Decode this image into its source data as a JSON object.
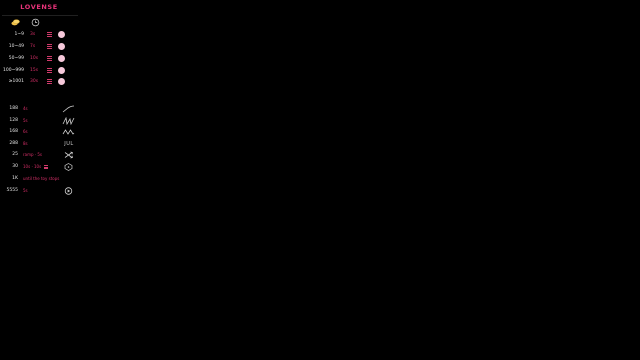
{
  "brand": {
    "name": "LOVENSE",
    "color": "#e8337a"
  },
  "colors": {
    "accent": "#d62f68",
    "text": "#e6e6e6",
    "background": "#000000"
  },
  "header": {
    "icons": [
      "tokens-icon",
      "timer-icon"
    ]
  },
  "tip_levels": [
    {
      "amount": "1~9",
      "duration": "3s",
      "level_icon": "level-bars-icon",
      "indicator_icon": "pink-dot-icon"
    },
    {
      "amount": "10~49",
      "duration": "7s",
      "level_icon": "level-bars-icon",
      "indicator_icon": "pink-dot-icon"
    },
    {
      "amount": "50~99",
      "duration": "10s",
      "level_icon": "level-bars-icon",
      "indicator_icon": "pink-dot-icon"
    },
    {
      "amount": "100~999",
      "duration": "15s",
      "level_icon": "level-bars-icon",
      "indicator_icon": "pink-dot-icon"
    },
    {
      "amount": "≥1001",
      "duration": "30s",
      "level_icon": "level-bars-icon",
      "indicator_icon": "pink-dot-icon"
    }
  ],
  "special_commands": [
    {
      "amount": "188",
      "duration": "4s",
      "icon": "wave-ramp-icon"
    },
    {
      "amount": "128",
      "duration": "5s",
      "icon": "pulse-icon"
    },
    {
      "amount": "168",
      "duration": "6s",
      "icon": "wave-icon"
    },
    {
      "amount": "288",
      "duration": "8s",
      "icon": "fireworks-icon",
      "icon_text": "JUL"
    },
    {
      "amount": "25",
      "duration": "ramp · 5s",
      "icon": "shuffle-icon"
    },
    {
      "amount": "30",
      "duration": "10s · 10s",
      "icon": "random-icon",
      "has_level": true
    },
    {
      "amount": "1K",
      "duration": "until the toy stops",
      "icon": ""
    },
    {
      "amount": "5555",
      "duration": "5s",
      "icon": "play-icon"
    }
  ]
}
